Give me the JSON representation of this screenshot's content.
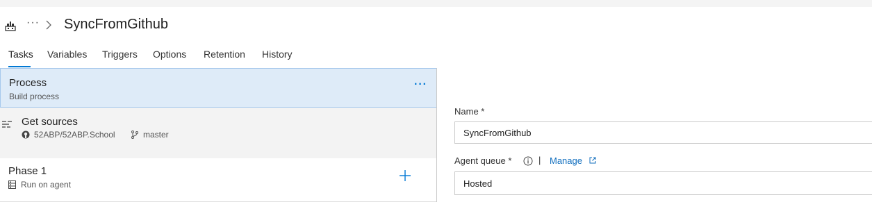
{
  "header": {
    "breadcrumb_more": "···",
    "title": "SyncFromGithub"
  },
  "tabs": [
    {
      "label": "Tasks",
      "active": true
    },
    {
      "label": "Variables"
    },
    {
      "label": "Triggers"
    },
    {
      "label": "Options"
    },
    {
      "label": "Retention"
    },
    {
      "label": "History"
    }
  ],
  "process": {
    "title": "Process",
    "subtitle": "Build process",
    "more_label": "···"
  },
  "get_sources": {
    "title": "Get sources",
    "repo": "52ABP/52ABP.School",
    "branch": "master"
  },
  "phase": {
    "title": "Phase 1",
    "subtitle": "Run on agent"
  },
  "form": {
    "name_label": "Name *",
    "name_value": "SyncFromGithub",
    "queue_label": "Agent queue *",
    "separator": "|",
    "manage_label": "Manage",
    "queue_value": "Hosted"
  },
  "colors": {
    "accent": "#0078d4",
    "selected_bg": "#deebf8",
    "panel_bg": "#f3f3f3"
  }
}
